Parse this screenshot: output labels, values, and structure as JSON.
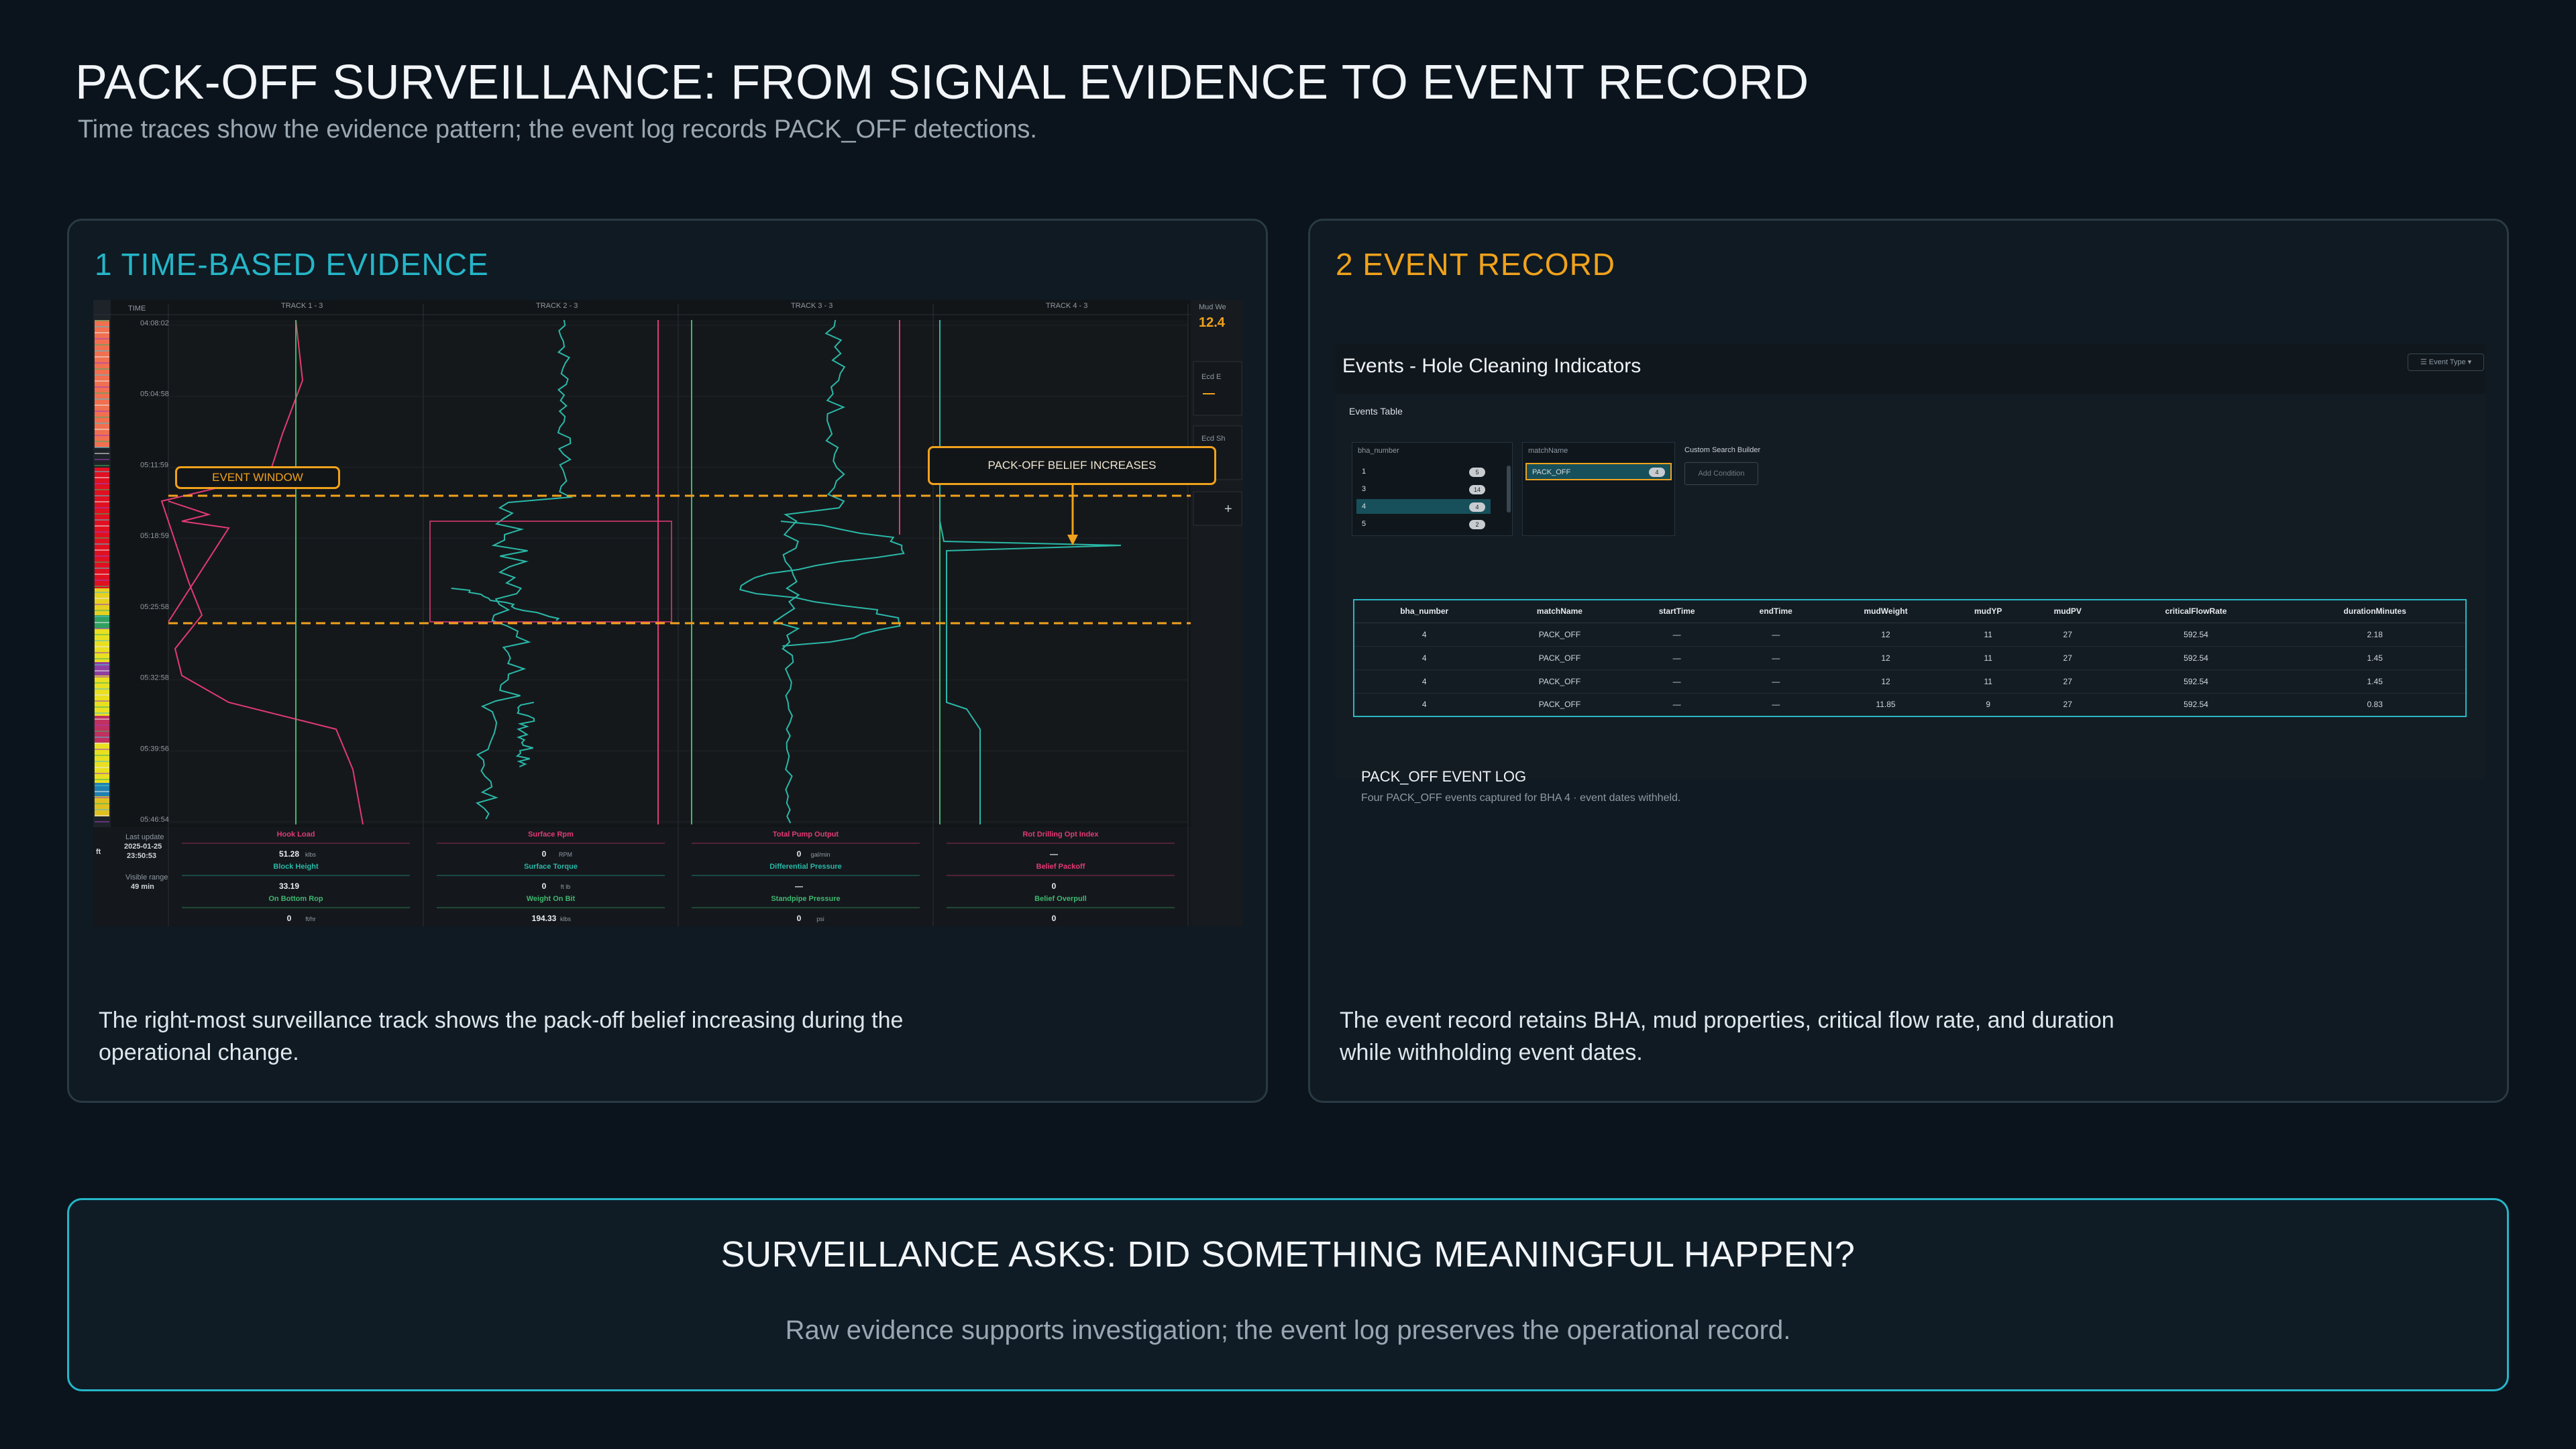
{
  "header": {
    "title": "PACK-OFF SURVEILLANCE: FROM SIGNAL EVIDENCE TO EVENT RECORD",
    "subtitle": "Time traces show the evidence pattern; the event log records PACK_OFF detections."
  },
  "panel1": {
    "heading": "1  TIME-BASED EVIDENCE",
    "caption": "The right-most surveillance track shows the pack-off belief increasing during the operational change.",
    "callouts": {
      "event_window": "EVENT WINDOW",
      "belief": "PACK-OFF BELIEF INCREASES"
    },
    "chart": {
      "time_header": "TIME",
      "tracks": [
        "TRACK 1 - 3",
        "TRACK 2 - 3",
        "TRACK 3 - 3",
        "TRACK 4 - 3"
      ],
      "times": [
        "04:08:02",
        "05:04:58",
        "05:11:59",
        "05:18:59",
        "05:25:58",
        "05:32:58",
        "05:39:56",
        "05:46:54"
      ],
      "side": {
        "label": "Mud We",
        "value": "12.4",
        "ecd1": "Ecd E",
        "ecd2": "Ecd Sh",
        "plus": "+"
      },
      "footer": {
        "last_update_label": "Last update",
        "last_update_date": "2025-01-25",
        "last_update_time": "23:50:53",
        "visible_range_label": "Visible range",
        "visible_range_value": "49 min",
        "readouts": [
          {
            "label": "Hook Load",
            "value": "51.28",
            "unit": "klbs",
            "color": "#e33a74"
          },
          {
            "label": "Surface Rpm",
            "value": "0",
            "unit": "RPM",
            "color": "#e33a74"
          },
          {
            "label": "Total Pump Output",
            "value": "0",
            "unit": "gal/min",
            "color": "#e33a74"
          },
          {
            "label": "Rot Drilling Opt Index",
            "value": "—",
            "unit": "",
            "color": "#e33a74"
          },
          {
            "label": "Block Height",
            "value": "33.19",
            "unit": "",
            "color": "#2ab8a8"
          },
          {
            "label": "Surface Torque",
            "value": "0",
            "unit": "ft lb",
            "color": "#2ab8a8"
          },
          {
            "label": "Differential Pressure",
            "value": "—",
            "unit": "",
            "color": "#2ab8a8"
          },
          {
            "label": "Belief Packoff",
            "value": "0",
            "unit": "",
            "color": "#e33a74"
          },
          {
            "label": "On Bottom Rop",
            "value": "0",
            "unit": "ft/hr",
            "color": "#3fb86f"
          },
          {
            "label": "Weight On Bit",
            "value": "194.33",
            "unit": "klbs",
            "color": "#3fb86f"
          },
          {
            "label": "Standpipe Pressure",
            "value": "0",
            "unit": "psi",
            "color": "#3fb86f"
          },
          {
            "label": "Belief Overpull",
            "value": "0",
            "unit": "",
            "color": "#3fb86f"
          }
        ]
      }
    }
  },
  "panel2": {
    "heading": "2  EVENT RECORD",
    "caption": "The event record retains BHA, mud properties, critical flow rate, and duration while withholding event dates.",
    "app": {
      "title": "Events - Hole Cleaning Indicators",
      "event_type_button": "Event Type",
      "table_label": "Events Table",
      "filter_bha_header": "bha_number",
      "filter_bha_rows": [
        {
          "value": "1",
          "count": "5"
        },
        {
          "value": "3",
          "count": "14"
        },
        {
          "value": "4",
          "count": "4"
        },
        {
          "value": "5",
          "count": "2"
        }
      ],
      "filter_match_header": "matchName",
      "filter_match_row": {
        "value": "PACK_OFF",
        "count": "4"
      },
      "custom_search_label": "Custom Search Builder",
      "add_condition_label": "Add Condition",
      "columns": [
        "bha_number",
        "matchName",
        "startTime",
        "endTime",
        "mudWeight",
        "mudYP",
        "mudPV",
        "criticalFlowRate",
        "durationMinutes"
      ],
      "rows": [
        [
          "4",
          "PACK_OFF",
          "—",
          "—",
          "12",
          "11",
          "27",
          "592.54",
          "2.18"
        ],
        [
          "4",
          "PACK_OFF",
          "—",
          "—",
          "12",
          "11",
          "27",
          "592.54",
          "1.45"
        ],
        [
          "4",
          "PACK_OFF",
          "—",
          "—",
          "12",
          "11",
          "27",
          "592.54",
          "1.45"
        ],
        [
          "4",
          "PACK_OFF",
          "—",
          "—",
          "11.85",
          "9",
          "27",
          "592.54",
          "0.83"
        ]
      ],
      "log_heading": "PACK_OFF EVENT LOG",
      "log_subtitle": "Four PACK_OFF events captured for BHA 4 · event dates withheld."
    }
  },
  "banner": {
    "heading": "SURVEILLANCE ASKS: DID SOMETHING MEANINGFUL HAPPEN?",
    "subtitle": "Raw evidence supports investigation; the event log preserves the operational record."
  },
  "colors": {
    "accent_teal": "#25b6c8",
    "accent_orange": "#f0a21c",
    "trace_pink": "#e33a74",
    "trace_teal": "#2ab8a8",
    "trace_green": "#3fb86f"
  }
}
